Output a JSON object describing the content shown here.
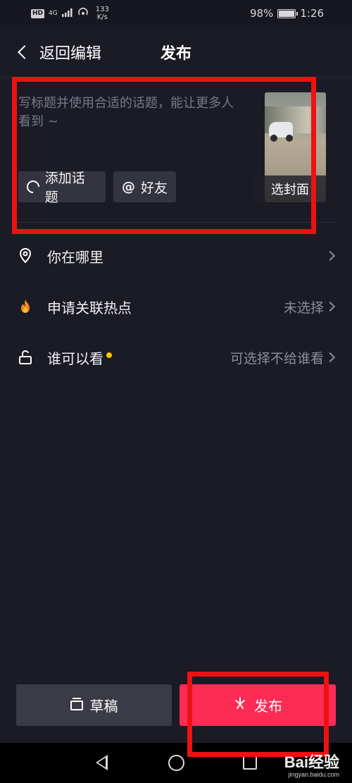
{
  "status_bar": {
    "hd": "HD",
    "network_type": "4G",
    "network_speed_value": "133",
    "network_speed_unit": "K/s",
    "battery_percent_text": "98%",
    "battery_level": 0.98,
    "time": "1:26"
  },
  "nav": {
    "back_label": "返回编辑",
    "title": "发布"
  },
  "compose": {
    "caption_placeholder": "写标题并使用合适的话题，能让更多人看到 ~",
    "topic_chip_label": "添加话题",
    "friend_chip_symbol": "@",
    "friend_chip_label": "好友",
    "cover_label": "选封面"
  },
  "settings": [
    {
      "icon": "location-pin-icon",
      "label": "你在哪里",
      "value": ""
    },
    {
      "icon": "flame-icon",
      "label": "申请关联热点",
      "value": "未选择"
    },
    {
      "icon": "unlock-icon",
      "label": "谁可以看",
      "value": "可选择不给谁看",
      "has_dot": true
    }
  ],
  "buttons": {
    "draft_label": "草稿",
    "publish_label": "发布"
  },
  "watermark": {
    "brand": "Bai经验",
    "url": "jingyan.baidu.com"
  },
  "colors": {
    "background": "#1a1b25",
    "publish_accent": "#fe2c55",
    "draft_button": "#3a3b46",
    "annotation_red": "#ee1111",
    "new_dot": "#f7c800"
  }
}
